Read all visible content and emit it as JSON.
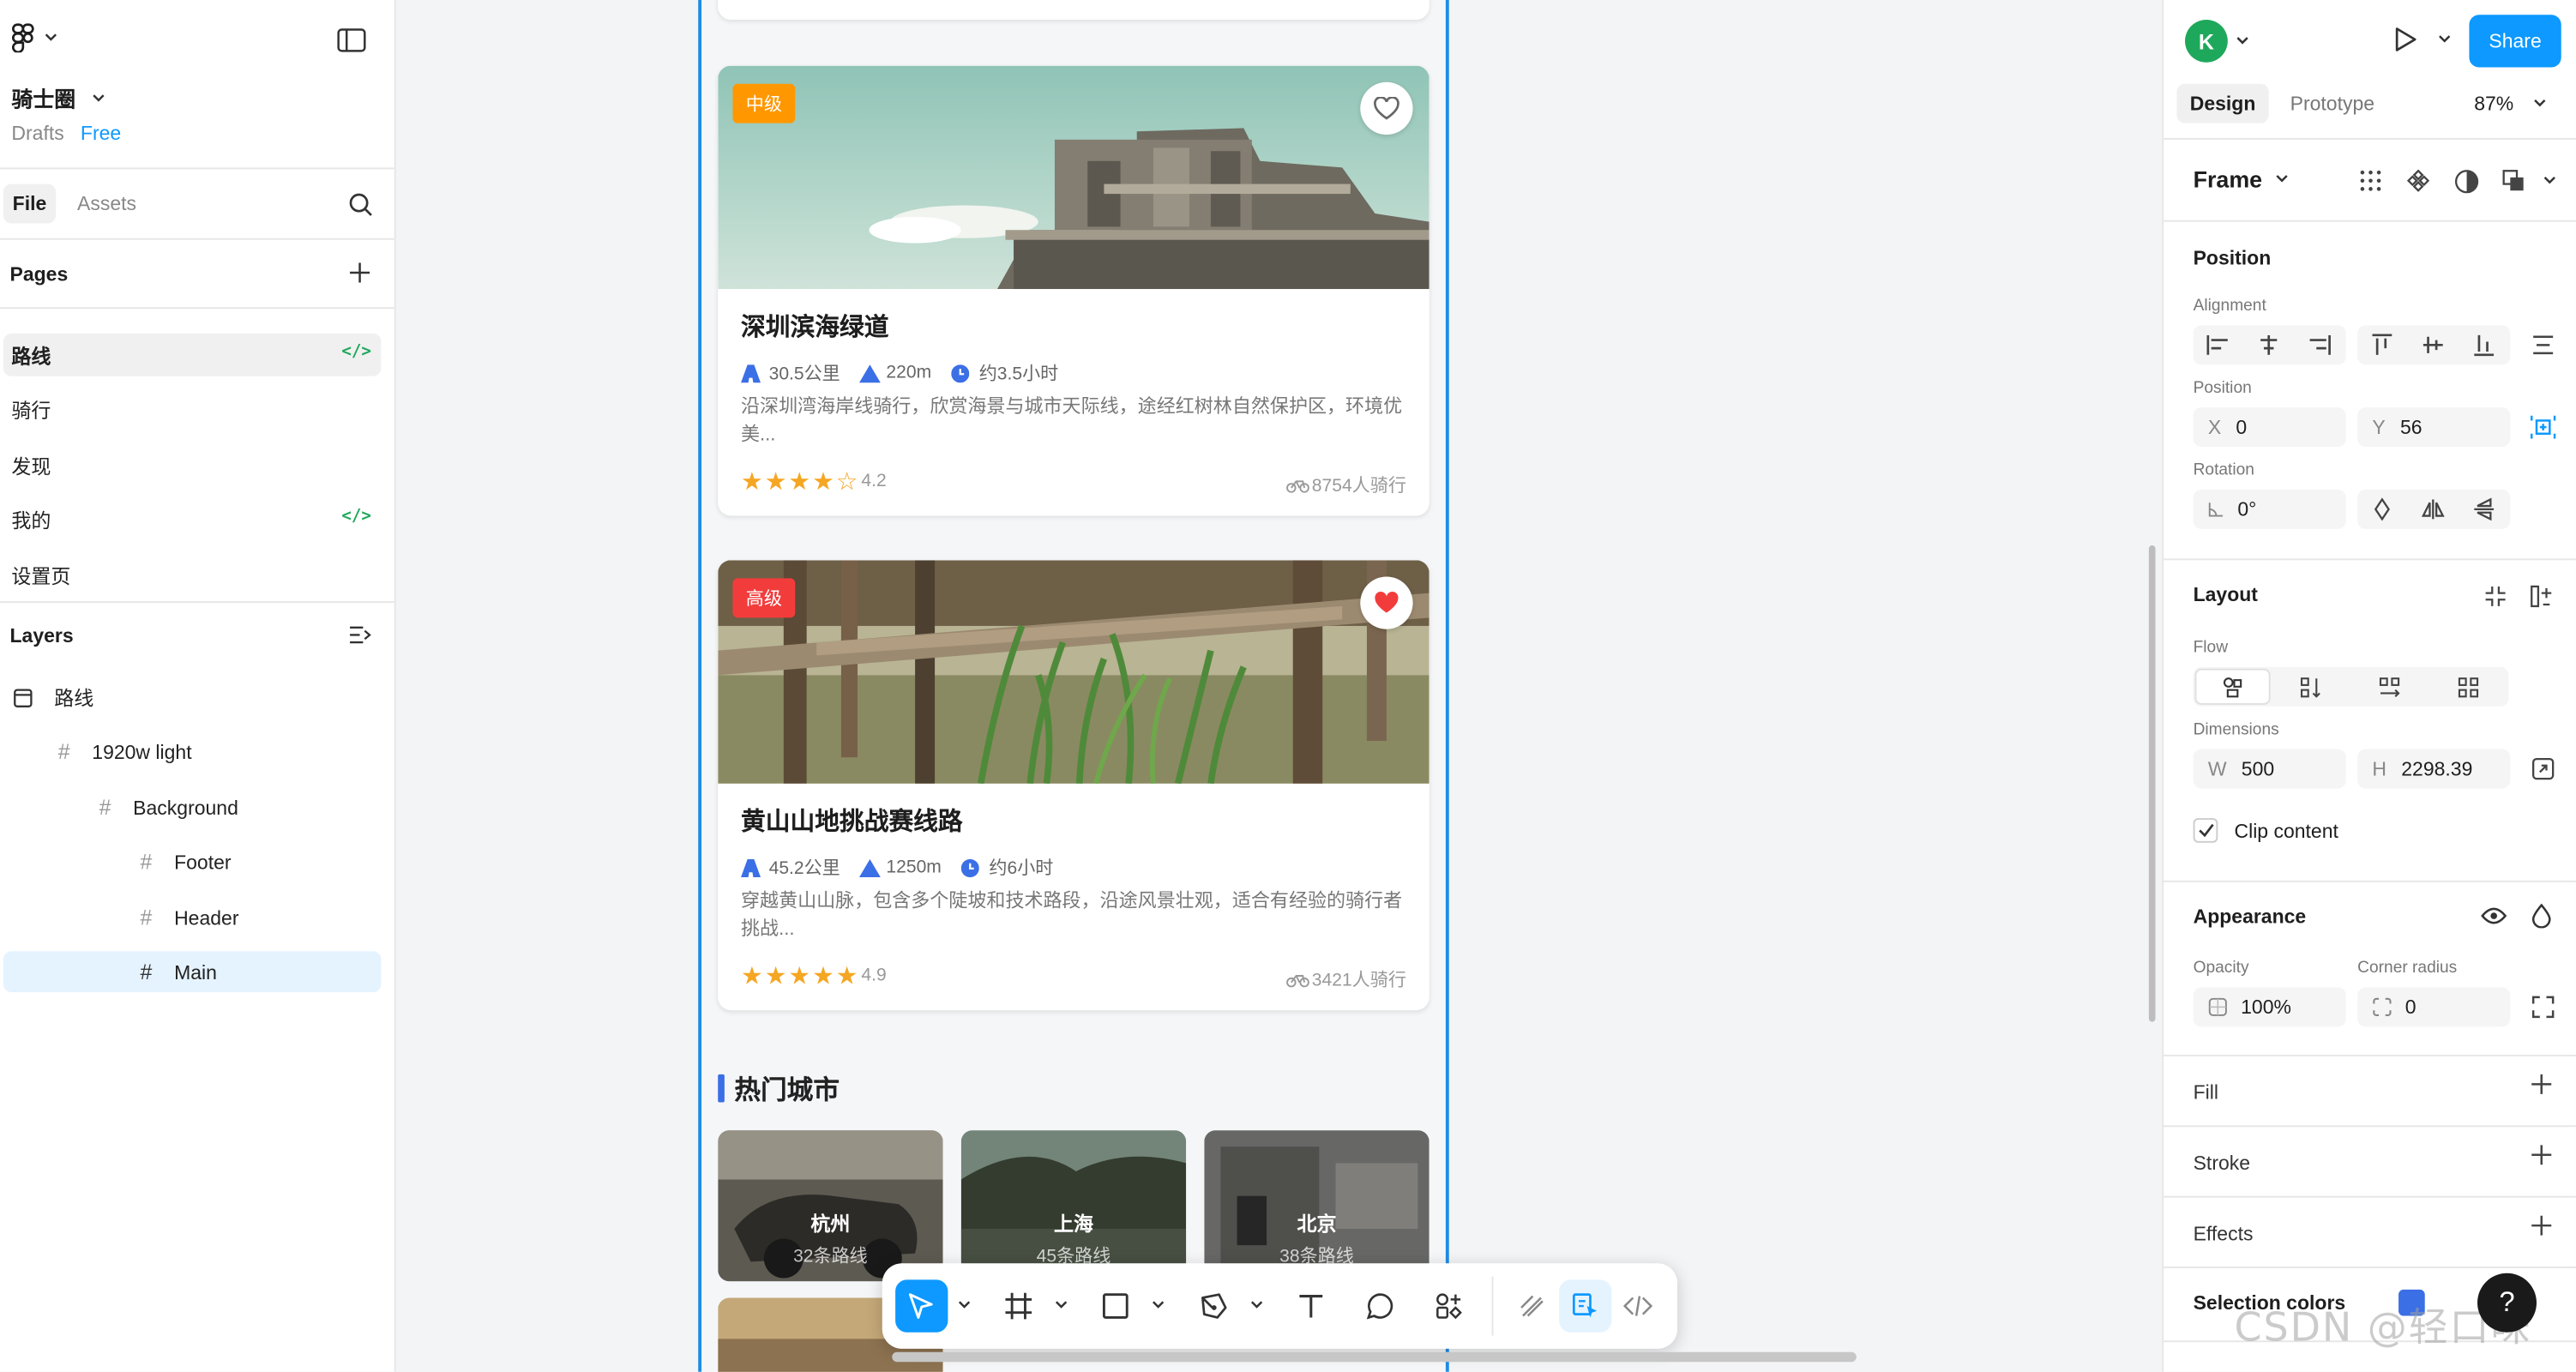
{
  "left_panel": {
    "project_name": "骑士圈",
    "drafts_label": "Drafts",
    "plan_badge": "Free",
    "tabs": {
      "file": "File",
      "assets": "Assets"
    },
    "pages_title": "Pages",
    "pages": [
      {
        "label": "路线",
        "has_code": true
      },
      {
        "label": "骑行",
        "has_code": false
      },
      {
        "label": "发现",
        "has_code": false
      },
      {
        "label": "我的",
        "has_code": true
      },
      {
        "label": "设置页",
        "has_code": false
      }
    ],
    "layers_title": "Layers",
    "layers": [
      {
        "label": "路线"
      },
      {
        "label": "1920w light"
      },
      {
        "label": "Background"
      },
      {
        "label": "Footer"
      },
      {
        "label": "Header"
      },
      {
        "label": "Main"
      }
    ]
  },
  "canvas": {
    "cards": [
      {
        "level": "中级",
        "level_color": "#ff9800",
        "favorited": false,
        "title": "深圳滨海绿道",
        "distance": "30.5公里",
        "elevation": "220m",
        "time": "约3.5小时",
        "description": "沿深圳湾海岸线骑行，欣赏海景与城市天际线，途经红树林自然保护区，环境优美...",
        "rating_value": 4.2,
        "rating": "4.2",
        "riders": "8754人骑行"
      },
      {
        "level": "高级",
        "level_color": "#f23c3c",
        "favorited": true,
        "title": "黄山山地挑战赛线路",
        "distance": "45.2公里",
        "elevation": "1250m",
        "time": "约6小时",
        "description": "穿越黄山山脉，包含多个陡坡和技术路段，沿途风景壮观，适合有经验的骑行者挑战...",
        "rating_value": 4.9,
        "rating": "4.9",
        "riders": "3421人骑行"
      }
    ],
    "section_title": "热门城市",
    "cities": [
      {
        "name": "杭州",
        "routes": "32条路线"
      },
      {
        "name": "上海",
        "routes": "45条路线"
      },
      {
        "name": "北京",
        "routes": "38条路线"
      }
    ]
  },
  "toolbar": {
    "tools": [
      "move-tool",
      "frame-tool",
      "rectangle-tool",
      "pen-tool",
      "text-tool",
      "comment-tool",
      "actions-tool",
      "draw-mode",
      "design-mode",
      "dev-mode"
    ]
  },
  "right_panel": {
    "avatar_letter": "K",
    "share_label": "Share",
    "tabs": {
      "design": "Design",
      "prototype": "Prototype"
    },
    "zoom": "87%",
    "frame_label": "Frame",
    "position_title": "Position",
    "alignment_label": "Alignment",
    "position_label": "Position",
    "x_label": "X",
    "x_value": "0",
    "y_label": "Y",
    "y_value": "56",
    "rotation_label": "Rotation",
    "rotation_value": "0°",
    "layout_title": "Layout",
    "flow_label": "Flow",
    "dimensions_label": "Dimensions",
    "w_label": "W",
    "w_value": "500",
    "h_label": "H",
    "h_value": "2298.39",
    "clip_label": "Clip content",
    "appearance_title": "Appearance",
    "opacity_label": "Opacity",
    "opacity_value": "100%",
    "radius_label": "Corner radius",
    "radius_value": "0",
    "fill_title": "Fill",
    "stroke_title": "Stroke",
    "effects_title": "Effects",
    "selection_colors_title": "Selection colors",
    "selection_color": "#3b6fe6",
    "help_label": "?",
    "watermark": "CSDN @轻口味"
  },
  "colors": {
    "accent": "#0d99ff",
    "selection": "#1e8ce6",
    "star": "#f5a623",
    "green": "#1ea85b"
  }
}
